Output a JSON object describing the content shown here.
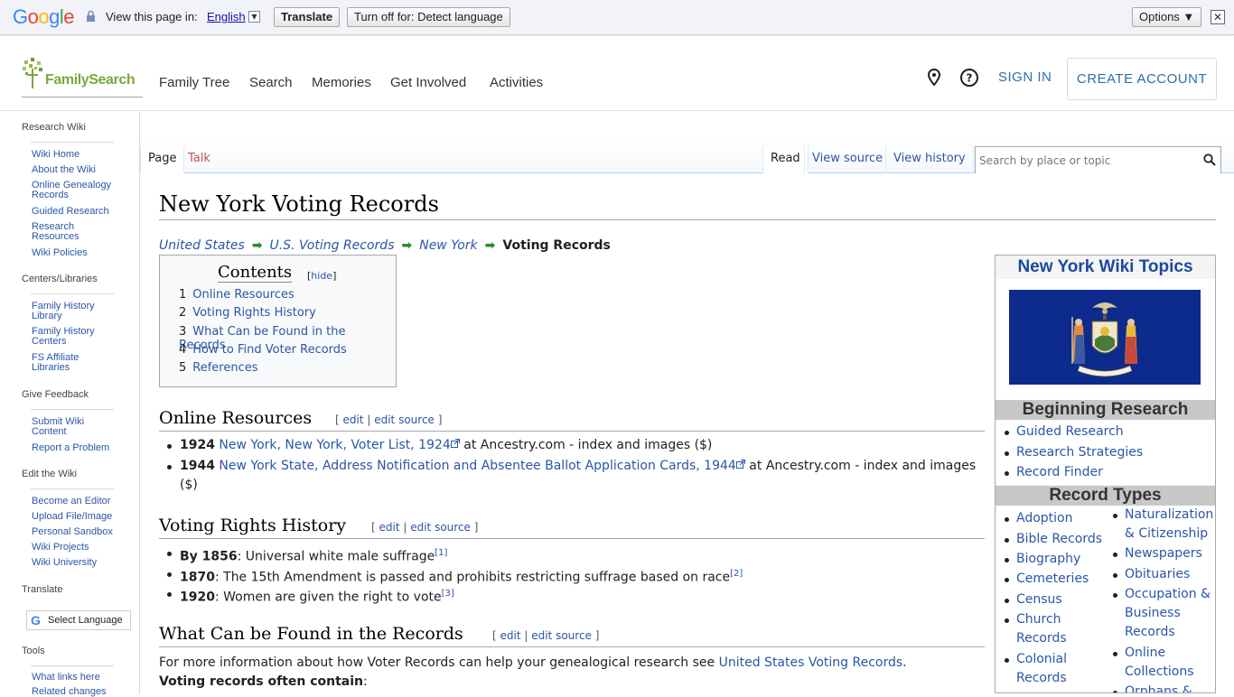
{
  "google_bar": {
    "logo": "Google",
    "view_in_label": "View this page in:",
    "language": "English",
    "translate_button": "Translate",
    "turn_off_button": "Turn off for: Detect language",
    "options_button": "Options ▼",
    "close": "✕"
  },
  "header": {
    "logo_text": "FamilySearch",
    "nav": [
      "Family Tree",
      "Search",
      "Memories",
      "Get Involved",
      "Activities"
    ],
    "sign_in": "SIGN IN",
    "create_account": "CREATE ACCOUNT"
  },
  "sidebar": {
    "research_wiki": "Research Wiki",
    "research_links": [
      "Wiki Home",
      "About the Wiki",
      "Online Genealogy Records",
      "Guided Research",
      "Research Resources",
      "Wiki Policies"
    ],
    "centers_head": "Centers/Libraries",
    "centers_links": [
      "Family History Library",
      "Family History Centers",
      "FS Affiliate Libraries"
    ],
    "feedback_head": "Give Feedback",
    "feedback_links": [
      "Submit Wiki Content",
      "Report a Problem"
    ],
    "edit_head": "Edit the Wiki",
    "edit_links": [
      "Become an Editor",
      "Upload File/Image",
      "Personal Sandbox",
      "Wiki Projects",
      "Wiki University"
    ],
    "translate_head": "Translate",
    "select_language": "Select Language",
    "tools_head": "Tools",
    "tools_links": [
      "What links here",
      "Related changes"
    ]
  },
  "tabs": {
    "page": "Page",
    "talk": "Talk",
    "read": "Read",
    "view_source": "View source",
    "view_history": "View history",
    "search_placeholder": "Search by place or topic"
  },
  "article": {
    "title": "New York Voting Records",
    "breadcrumbs": [
      "United States",
      "U.S. Voting Records",
      "New York"
    ],
    "breadcrumb_current": "Voting Records",
    "toc_title": "Contents",
    "toc_hide": "hide",
    "toc": [
      {
        "num": "1",
        "label": "Online Resources"
      },
      {
        "num": "2",
        "label": "Voting Rights History"
      },
      {
        "num": "3",
        "label": "What Can be Found in the Records"
      },
      {
        "num": "4",
        "label": "How to Find Voter Records"
      },
      {
        "num": "5",
        "label": "References"
      }
    ],
    "edit": "edit",
    "edit_source": "edit source",
    "sections": {
      "online": "Online Resources",
      "history": "Voting Rights History",
      "found": "What Can be Found in the Records"
    },
    "online_items": [
      {
        "year": "1924",
        "link": "New York, New York, Voter List, 1924",
        "rest": " at Ancestry.com - index and images ($)"
      },
      {
        "year": "1944",
        "link": "New York State, Address Notification and Absentee Ballot Application Cards, 1944",
        "rest": " at Ancestry.com - index and images ($)"
      }
    ],
    "history_items": [
      {
        "year": "By 1856",
        "text": ": Universal white male suffrage",
        "ref": "[1]"
      },
      {
        "year": "1870",
        "text": ": The 15th Amendment is passed and prohibits restricting suffrage based on race",
        "ref": "[2]"
      },
      {
        "year": "1920",
        "text": ": Women are given the right to vote",
        "ref": "[3]"
      }
    ],
    "found_text": "For more information about how Voter Records can help your genealogical research see ",
    "found_link": "United States Voting Records",
    "found_end": ".",
    "contain_label": "Voting records often contain",
    "contain_colon": ":"
  },
  "infobox": {
    "title": "New York Wiki Topics",
    "beginning_head": "Beginning Research",
    "beginning_items": [
      "Guided Research",
      "Research Strategies",
      "Record Finder"
    ],
    "record_types_head": "Record Types",
    "record_types_left": [
      "Adoption",
      "Bible Records",
      "Biography",
      "Cemeteries",
      "Census",
      "Church Records",
      "Colonial Records"
    ],
    "record_types_right": [
      "Naturalization & Citizenship",
      "Newspapers",
      "Obituaries",
      "Occupation & Business Records",
      "Online Collections",
      "Orphans &"
    ]
  },
  "colors": {
    "link": "#2a56a6",
    "talk_red": "#ba5a4a",
    "fs_green": "#7aa83c",
    "flag_blue": "#0d2b8c"
  }
}
